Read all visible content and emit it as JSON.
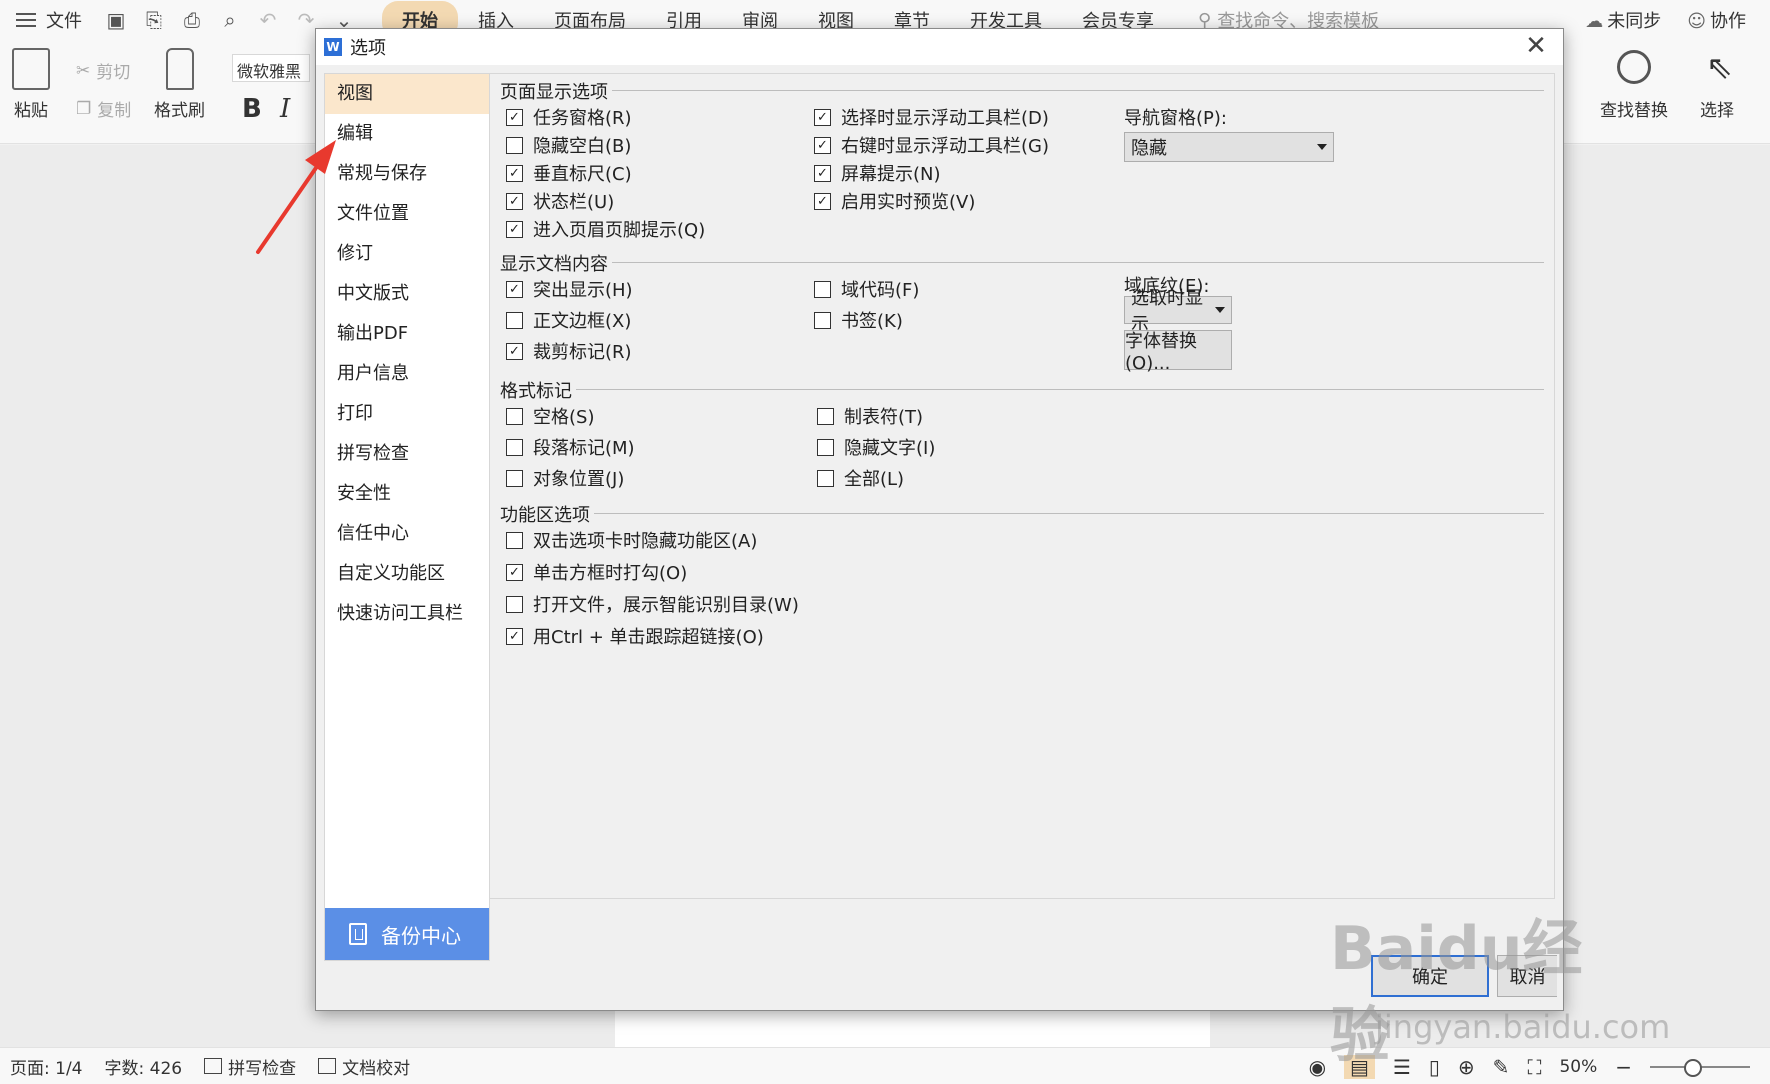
{
  "app": {
    "menubar": {
      "file_label": "文件",
      "tabs": [
        "开始",
        "插入",
        "页面布局",
        "引用",
        "审阅",
        "视图",
        "章节",
        "开发工具",
        "会员专享"
      ],
      "search_placeholder": "查找命令、搜索模板",
      "sync_label": "未同步",
      "collab_label": "协作"
    },
    "ribbon": {
      "paste_label": "粘贴",
      "cut_label": "剪切",
      "copy_label": "复制",
      "format_painter_label": "格式刷",
      "font_name": "微软雅黑",
      "bold_glyph": "B",
      "italic_glyph": "I",
      "find_replace_label": "查找替换",
      "select_label": "选择"
    },
    "statusbar": {
      "page": "页面: 1/4",
      "word_count": "字数: 426",
      "spell_check": "拼写检查",
      "doc_proof": "文档校对",
      "zoom": "50%"
    }
  },
  "dialog": {
    "logo": "W",
    "title": "选项",
    "nav": [
      "视图",
      "编辑",
      "常规与保存",
      "文件位置",
      "修订",
      "中文版式",
      "输出PDF",
      "用户信息",
      "打印",
      "拼写检查",
      "安全性",
      "信任中心",
      "自定义功能区",
      "快速访问工具栏"
    ],
    "backup_label": "备份中心",
    "sections": {
      "page_display": {
        "title": "页面显示选项",
        "options_left": [
          {
            "label": "任务窗格(R)",
            "checked": true
          },
          {
            "label": "隐藏空白(B)",
            "checked": false
          },
          {
            "label": "垂直标尺(C)",
            "checked": true
          },
          {
            "label": "状态栏(U)",
            "checked": true
          },
          {
            "label": "进入页眉页脚提示(Q)",
            "checked": true
          }
        ],
        "options_mid": [
          {
            "label": "选择时显示浮动工具栏(D)",
            "checked": true
          },
          {
            "label": "右键时显示浮动工具栏(G)",
            "checked": true
          },
          {
            "label": "屏幕提示(N)",
            "checked": true
          },
          {
            "label": "启用实时预览(V)",
            "checked": true
          }
        ],
        "nav_pane_label": "导航窗格(P):",
        "nav_pane_value": "隐藏"
      },
      "doc_content": {
        "title": "显示文档内容",
        "options_left": [
          {
            "label": "突出显示(H)",
            "checked": true
          },
          {
            "label": "正文边框(X)",
            "checked": false
          },
          {
            "label": "裁剪标记(R)",
            "checked": true
          }
        ],
        "options_mid": [
          {
            "label": "域代码(F)",
            "checked": false
          },
          {
            "label": "书签(K)",
            "checked": false
          }
        ],
        "field_shading_label": "域底纹(E):",
        "field_shading_value": "选取时显示",
        "font_sub_button": "字体替换(O)..."
      },
      "format_marks": {
        "title": "格式标记",
        "options_left": [
          {
            "label": "空格(S)",
            "checked": false
          },
          {
            "label": "段落标记(M)",
            "checked": false
          },
          {
            "label": "对象位置(J)",
            "checked": false
          }
        ],
        "options_mid": [
          {
            "label": "制表符(T)",
            "checked": false
          },
          {
            "label": "隐藏文字(I)",
            "checked": false
          },
          {
            "label": "全部(L)",
            "checked": false
          }
        ]
      },
      "ribbon_options": {
        "title": "功能区选项",
        "options": [
          {
            "label": "双击选项卡时隐藏功能区(A)",
            "checked": false
          },
          {
            "label": "单击方框时打勾(O)",
            "checked": true
          },
          {
            "label": "打开文件，展示智能识别目录(W)",
            "checked": false
          },
          {
            "label": "用Ctrl + 单击跟踪超链接(O)",
            "checked": true
          }
        ]
      }
    },
    "ok_label": "确定",
    "cancel_label": "取消"
  },
  "watermark": {
    "brand": "Baidu经验",
    "url": "jingyan.baidu.com"
  },
  "colors": {
    "accent_tab": "#f3d9b2",
    "nav_active": "#fbe7cc",
    "backup_blue": "#5b8fe6",
    "arrow_red": "#e8392e"
  }
}
